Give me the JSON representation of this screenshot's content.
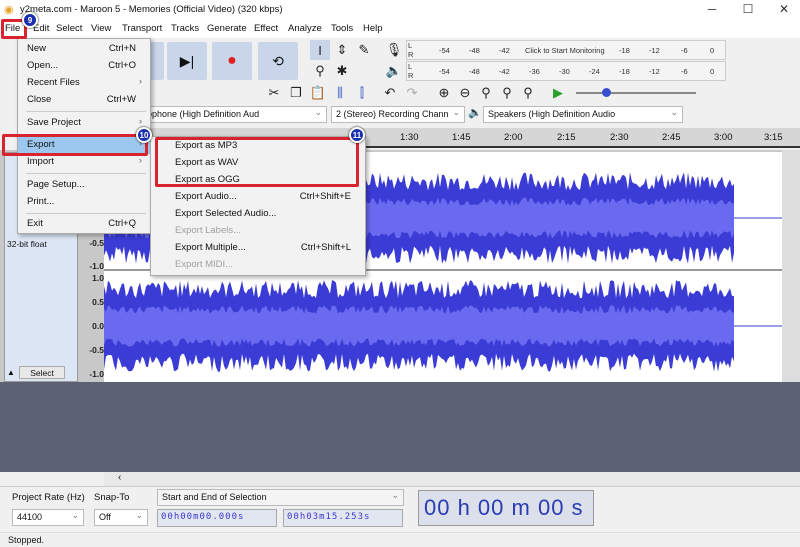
{
  "window": {
    "title": "y2meta.com - Maroon 5 - Memories (Official Video) (320 kbps)",
    "minimize": "─",
    "maximize": "☐",
    "close": "✕"
  },
  "menubar": [
    "File",
    "Edit",
    "Select",
    "View",
    "Transport",
    "Tracks",
    "Generate",
    "Effect",
    "Analyze",
    "Tools",
    "Help"
  ],
  "meters": {
    "record_labels": [
      "-54",
      "-48",
      "-42",
      "Click to Start Monitoring",
      "-18",
      "-12",
      "-6",
      "0"
    ],
    "play_labels": [
      "-54",
      "-48",
      "-42",
      "-36",
      "-30",
      "-24",
      "-18",
      "-12",
      "-6",
      "0"
    ],
    "lr": [
      "L",
      "R"
    ]
  },
  "devices": {
    "input": "ophone (High Definition Aud",
    "channels": "2 (Stereo) Recording Chann",
    "output": "Speakers (High Definition Audio"
  },
  "ruler": [
    "1:30",
    "1:45",
    "2:00",
    "2:15",
    "2:30",
    "2:45",
    "3:00",
    "3:15"
  ],
  "track": {
    "format": "32-bit float",
    "select_label": "Select",
    "scale1": [
      "-0.5",
      "-1.0"
    ],
    "scale2": [
      "1.0",
      "0.5",
      "0.0",
      "-0.5",
      "-1.0"
    ]
  },
  "file_menu": {
    "items": [
      {
        "label": "New",
        "shortcut": "Ctrl+N"
      },
      {
        "label": "Open...",
        "shortcut": "Ctrl+O"
      },
      {
        "label": "Recent Files",
        "submenu": true
      },
      {
        "label": "Close",
        "shortcut": "Ctrl+W"
      },
      {
        "label": "Save Project",
        "submenu": true
      },
      {
        "label": "Export",
        "submenu": true,
        "highlighted": true
      },
      {
        "label": "Import",
        "submenu": true
      },
      {
        "label": "Page Setup..."
      },
      {
        "label": "Print..."
      },
      {
        "label": "Exit",
        "shortcut": "Ctrl+Q"
      }
    ]
  },
  "export_menu": {
    "items": [
      {
        "label": "Export as MP3"
      },
      {
        "label": "Export as WAV"
      },
      {
        "label": "Export as OGG"
      },
      {
        "label": "Export Audio...",
        "shortcut": "Ctrl+Shift+E"
      },
      {
        "label": "Export Selected Audio..."
      },
      {
        "label": "Export Labels...",
        "disabled": true
      },
      {
        "label": "Export Multiple...",
        "shortcut": "Ctrl+Shift+L"
      },
      {
        "label": "Export MIDI...",
        "disabled": true
      }
    ]
  },
  "badges": [
    "9",
    "10",
    "11"
  ],
  "selection_toolbar": {
    "project_rate_label": "Project Rate (Hz)",
    "project_rate": "44100",
    "snap_label": "Snap-To",
    "snap": "Off",
    "selection_mode": "Start and End of Selection",
    "start": "00h00m00.000s",
    "end": "00h03m15.253s",
    "position": "00 h 00 m 00 s"
  },
  "status": "Stopped.",
  "colors": {
    "waveform": "#3b3bd6",
    "waveform_rms": "#6a6af0",
    "highlight": "#9cc7ee",
    "annotation_red": "#d9232e",
    "badge": "#1a2fb0"
  }
}
